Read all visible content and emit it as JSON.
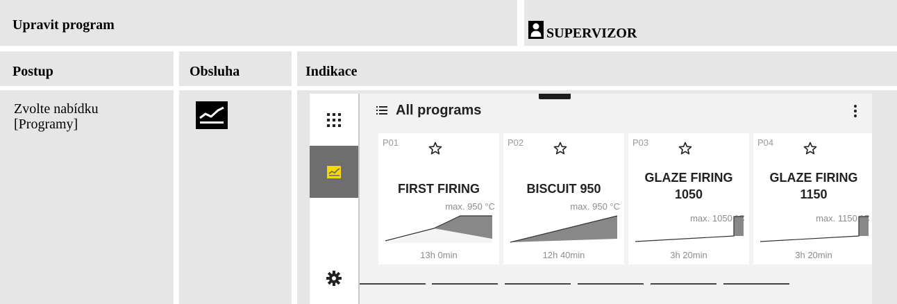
{
  "header": {
    "title": "Upravit program",
    "user_label": "SUPERVIZOR"
  },
  "columns": {
    "postup": "Postup",
    "obsluha": "Obsluha",
    "indikace": "Indikace"
  },
  "step": {
    "line1": "Zvolte nabídku",
    "line2": "[Programy]"
  },
  "screen": {
    "title": "All programs",
    "accent_color": "#f5d800",
    "rail": [
      {
        "icon": "apps-grid-icon",
        "active": false
      },
      {
        "icon": "program-curve-icon",
        "active": true
      },
      {
        "icon": "gear-icon",
        "active": false
      }
    ],
    "programs": [
      {
        "id": "P01",
        "name_line1": "FIRST FIRING",
        "name_line2": "",
        "max": "max. 950 °C",
        "duration": "13h 0min"
      },
      {
        "id": "P02",
        "name_line1": "BISCUIT 950",
        "name_line2": "",
        "max": "max. 950 °C",
        "duration": "12h 40min"
      },
      {
        "id": "P03",
        "name_line1": "GLAZE FIRING",
        "name_line2": "1050",
        "max": "max. 1050 °C",
        "duration": "3h 20min"
      },
      {
        "id": "P04",
        "name_line1": "GLAZE FIRING",
        "name_line2": "1150",
        "max": "max. 1150 °C",
        "duration": "3h 20min"
      }
    ]
  }
}
